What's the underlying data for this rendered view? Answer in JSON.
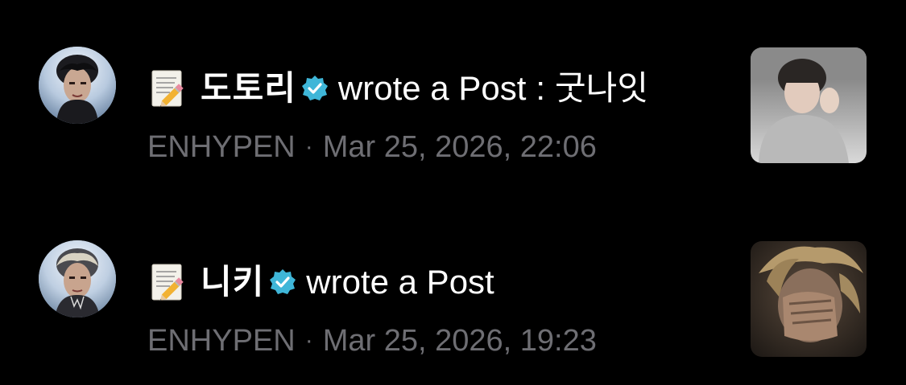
{
  "notifications": [
    {
      "author": "도토리",
      "action": "wrote a Post",
      "separator": ":",
      "post_title": "굿나잇",
      "group": "ENHYPEN",
      "meta_dot": "·",
      "timestamp": "Mar 25, 2026, 22:06",
      "verified": true,
      "icon": "memo-icon"
    },
    {
      "author": "니키",
      "action": "wrote a Post",
      "group": "ENHYPEN",
      "meta_dot": "·",
      "timestamp": "Mar 25, 2026, 19:23",
      "verified": true,
      "icon": "memo-icon"
    }
  ],
  "colors": {
    "background": "#000000",
    "text_primary": "#ffffff",
    "text_secondary": "#6e6e73",
    "verified_badge": "#3fb6d8"
  }
}
